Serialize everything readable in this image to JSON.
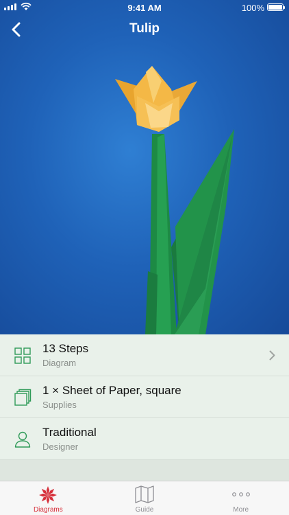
{
  "status_bar": {
    "time": "9:41 AM",
    "battery": "100%"
  },
  "nav": {
    "title": "Tulip",
    "back_icon": "chevron-left-icon"
  },
  "colors": {
    "accent": "#d6303b",
    "icon_green": "#2f9a58",
    "list_bg": "#e9f1ea",
    "sky": "#1f62b8"
  },
  "details": [
    {
      "title": "13 Steps",
      "subtitle": "Diagram",
      "icon": "grid-icon",
      "has_chevron": true
    },
    {
      "title": "1 × Sheet of Paper, square",
      "subtitle": "Supplies",
      "icon": "paper-stack-icon",
      "has_chevron": false
    },
    {
      "title": "Traditional",
      "subtitle": "Designer",
      "icon": "person-icon",
      "has_chevron": false
    }
  ],
  "tabs": [
    {
      "label": "Diagrams",
      "icon": "flower-icon",
      "active": true
    },
    {
      "label": "Guide",
      "icon": "map-icon",
      "active": false
    },
    {
      "label": "More",
      "icon": "ellipsis-icon",
      "active": false
    }
  ]
}
